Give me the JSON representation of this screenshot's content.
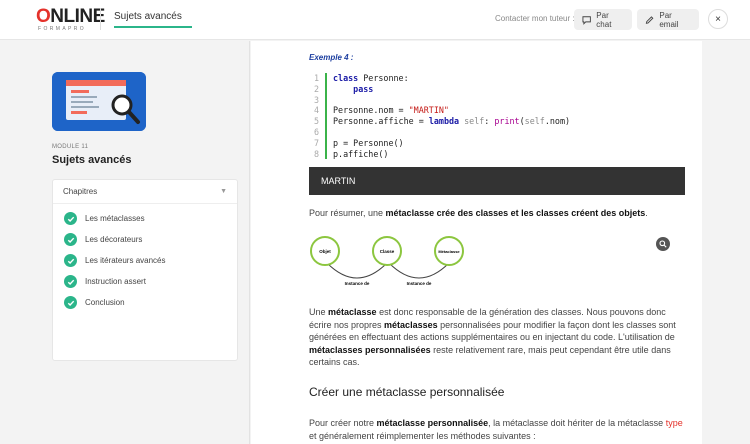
{
  "header": {
    "logo_text_before": "",
    "logo_o": "O",
    "logo_text_after": "NLINE",
    "logo_sub": "FORMAPRO",
    "course_title": "Sujets avancés",
    "progress_fraction": 1.0,
    "tutor_label": "Contacter mon tuteur :",
    "chat_label": "Par chat",
    "mail_label": "Par email",
    "close_glyph": "×"
  },
  "sidebar": {
    "module_label": "MODULE 11",
    "module_title": "Sujets avancés",
    "chapters_header": "Chapitres",
    "chapters": [
      {
        "label": "Les métaclasses",
        "done": true
      },
      {
        "label": "Les décorateurs",
        "done": true
      },
      {
        "label": "Les itérateurs avancés",
        "done": true
      },
      {
        "label": "Instruction assert",
        "done": true
      },
      {
        "label": "Conclusion",
        "done": true
      }
    ]
  },
  "main": {
    "example_label": "Exemple 4 :",
    "code_line_numbers": [
      "1",
      "2",
      "3",
      "4",
      "5",
      "6",
      "7",
      "8"
    ],
    "output_text": "MARTIN",
    "summary_before": "Pour résumer, une ",
    "summary_bold": "métaclasse crée des classes et les classes créent des objets",
    "summary_after": ".",
    "diagram": {
      "node_objet": "Objet",
      "node_classe": "Classe",
      "node_metaclasse": "Métaclasse",
      "edge_1": "Instance de",
      "edge_2": "Instance de"
    },
    "p2_a": "Une ",
    "p2_b": "métaclasse",
    "p2_c": " est donc responsable de la génération des classes. Nous pouvons donc écrire nos propres ",
    "p2_d": "métaclasses",
    "p2_e": " personnalisées pour modifier la façon dont les classes sont générées en effectuant des actions supplémentaires ou en injectant du code. L'utilisation de ",
    "p2_f": "métaclasses personnalisées",
    "p2_g": " reste relativement rare, mais peut cependant être utile dans certains cas.",
    "heading": "Créer une métaclasse personnalisée",
    "p3_a": "Pour créer notre ",
    "p3_b": "métaclasse personnalisée",
    "p3_c": ", la métaclasse doit hériter de la métaclasse ",
    "p3_d": "type",
    "p3_e": " et généralement réimplementer les méthodes suivantes :"
  },
  "colors": {
    "accent_green": "#2bb58a",
    "brand_red": "#e4322b",
    "output_bg": "#333333"
  }
}
